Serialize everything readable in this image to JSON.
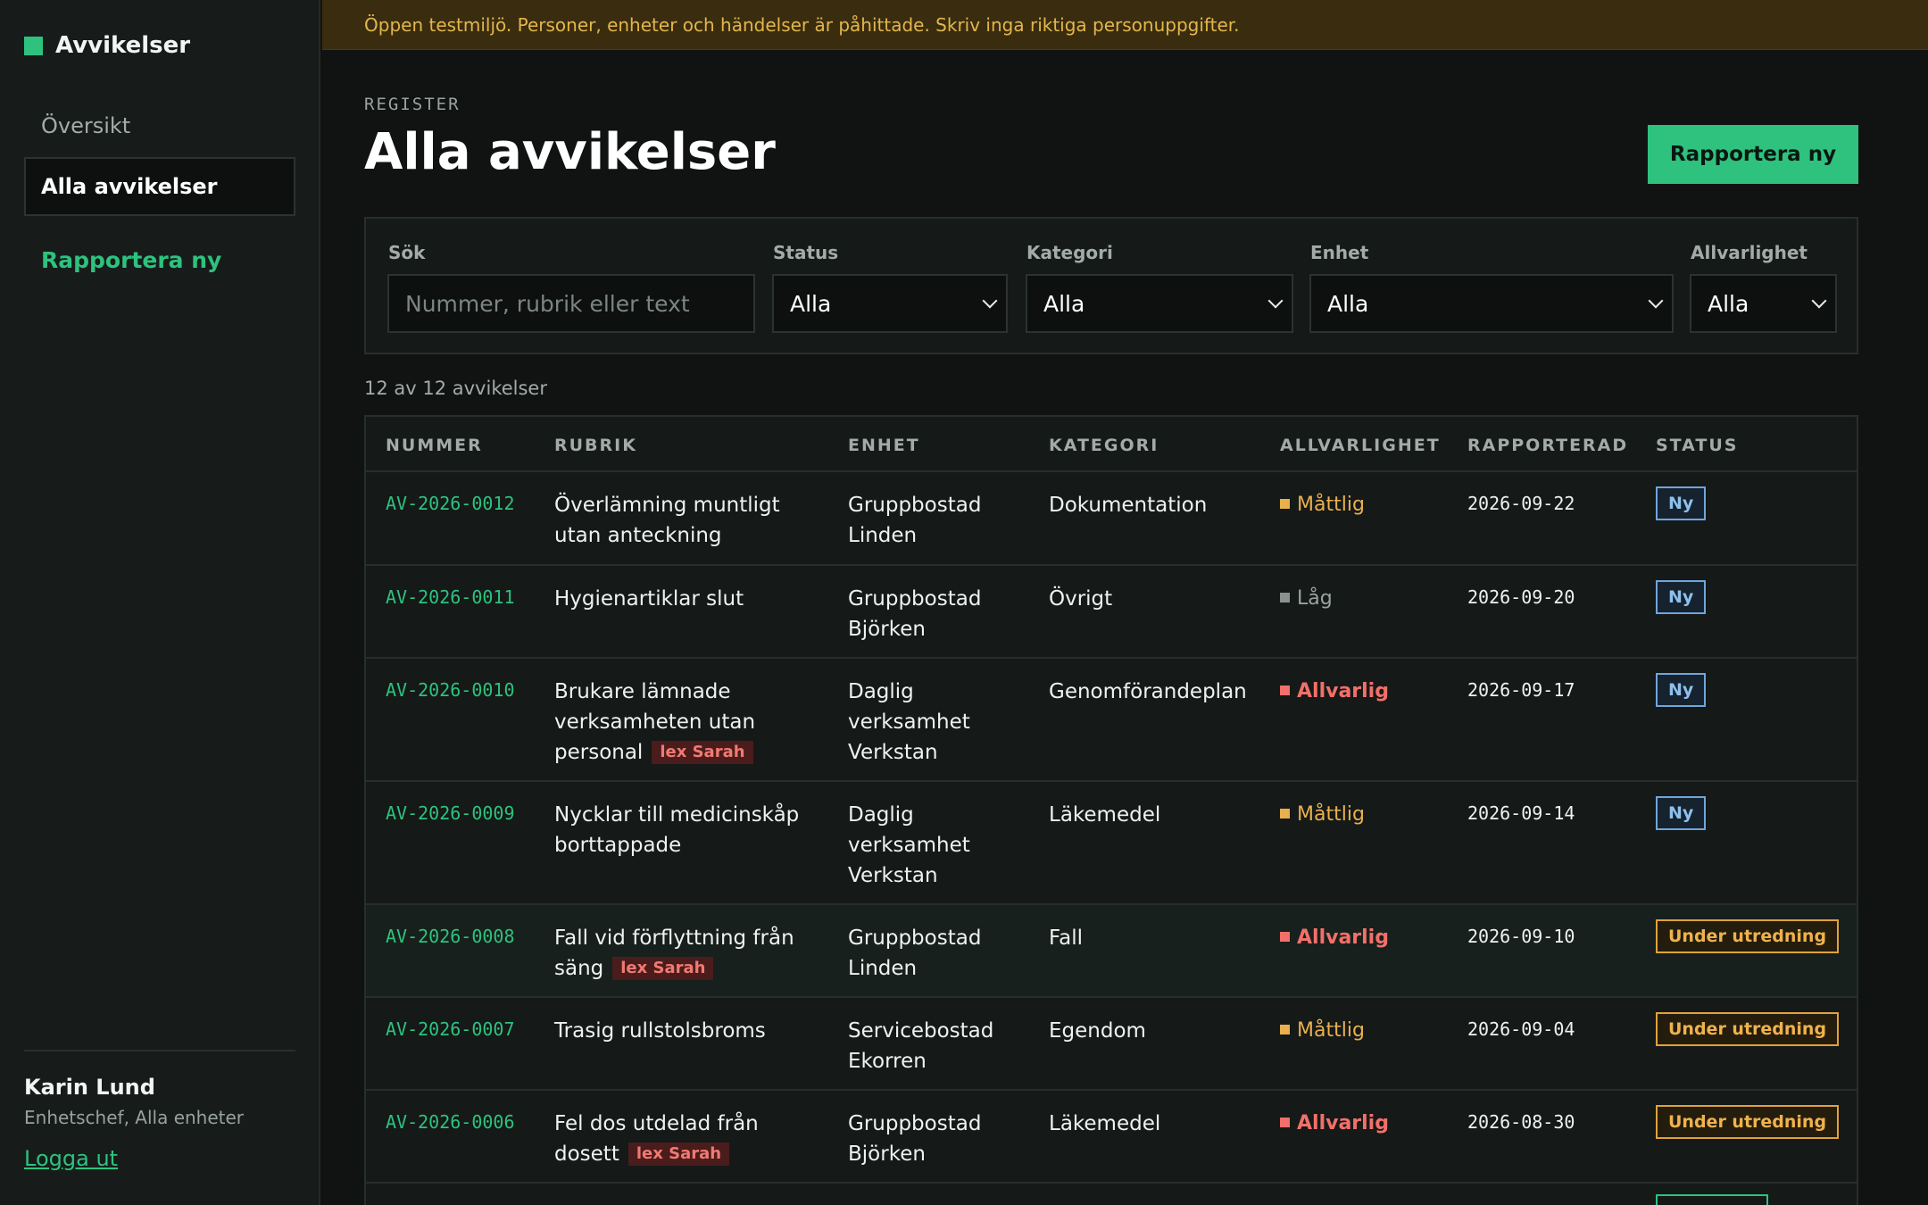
{
  "brand": {
    "name": "Avvikelser",
    "color": "#2ec27e"
  },
  "nav": {
    "overview": "Översikt",
    "all": "Alla avvikelser",
    "report": "Rapportera ny"
  },
  "user": {
    "name": "Karin Lund",
    "role": "Enhetschef, Alla enheter",
    "logout": "Logga ut"
  },
  "banner": "Öppen testmiljö. Personer, enheter och händelser är påhittade. Skriv inga riktiga personuppgifter.",
  "header": {
    "eyebrow": "REGISTER",
    "title": "Alla avvikelser",
    "report_button": "Rapportera ny"
  },
  "filters": {
    "search_label": "Sök",
    "search_placeholder": "Nummer, rubrik eller text",
    "status_label": "Status",
    "status_value": "Alla",
    "category_label": "Kategori",
    "category_value": "Alla",
    "unit_label": "Enhet",
    "unit_value": "Alla",
    "severity_label": "Allvarlighet",
    "severity_value": "Alla"
  },
  "count": "12 av 12 avvikelser",
  "table": {
    "headers": {
      "number": "NUMMER",
      "title": "RUBRIK",
      "unit": "ENHET",
      "category": "KATEGORI",
      "severity": "ALLVARLIGHET",
      "reported": "RAPPORTERAD",
      "status": "STATUS"
    },
    "lex_label": "lex Sarah",
    "rows": [
      {
        "number": "AV-2026-0012",
        "title_lines": [
          "Överlämning muntligt",
          "utan anteckning"
        ],
        "unit_lines": [
          "Gruppbostad",
          "Linden"
        ],
        "category": "Dokumentation",
        "severity": "Måttlig",
        "reported": "2026-09-22",
        "status": "Ny"
      },
      {
        "number": "AV-2026-0011",
        "title_lines": [
          "Hygienartiklar slut"
        ],
        "unit_lines": [
          "Gruppbostad",
          "Björken"
        ],
        "category": "Övrigt",
        "severity": "Låg",
        "reported": "2026-09-20",
        "status": "Ny"
      },
      {
        "number": "AV-2026-0010",
        "title_lines": [
          "Brukare lämnade",
          "verksamheten utan",
          "personal"
        ],
        "unit_lines": [
          "Daglig",
          "verksamhet",
          "Verkstan"
        ],
        "category": "Genomförandeplan",
        "severity": "Allvarlig",
        "reported": "2026-09-17",
        "status": "Ny"
      },
      {
        "number": "AV-2026-0009",
        "title_lines": [
          "Nycklar till medicinskåp",
          "borttappade"
        ],
        "unit_lines": [
          "Daglig",
          "verksamhet",
          "Verkstan"
        ],
        "category": "Läkemedel",
        "severity": "Måttlig",
        "reported": "2026-09-14",
        "status": "Ny"
      },
      {
        "number": "AV-2026-0008",
        "title_lines": [
          "Fall vid förflyttning från",
          "säng"
        ],
        "unit_lines": [
          "Gruppbostad",
          "Linden"
        ],
        "category": "Fall",
        "severity": "Allvarlig",
        "reported": "2026-09-10",
        "status": "Under utredning"
      },
      {
        "number": "AV-2026-0007",
        "title_lines": [
          "Trasig rullstolsbroms"
        ],
        "unit_lines": [
          "Servicebostad",
          "Ekorren"
        ],
        "category": "Egendom",
        "severity": "Måttlig",
        "reported": "2026-09-04",
        "status": "Under utredning"
      },
      {
        "number": "AV-2026-0006",
        "title_lines": [
          "Fel dos utdelad från",
          "dosett"
        ],
        "unit_lines": [
          "Gruppbostad",
          "Björken"
        ],
        "category": "Läkemedel",
        "severity": "Allvarlig",
        "reported": "2026-08-30",
        "status": "Under utredning"
      }
    ]
  },
  "colors": {
    "accent": "#2ec27e",
    "severity_moderate": "#e9b04c",
    "severity_low": "#8a928f",
    "severity_serious": "#f2706a",
    "status_new": "#6ea6dc",
    "status_investigation": "#e0a23c"
  }
}
